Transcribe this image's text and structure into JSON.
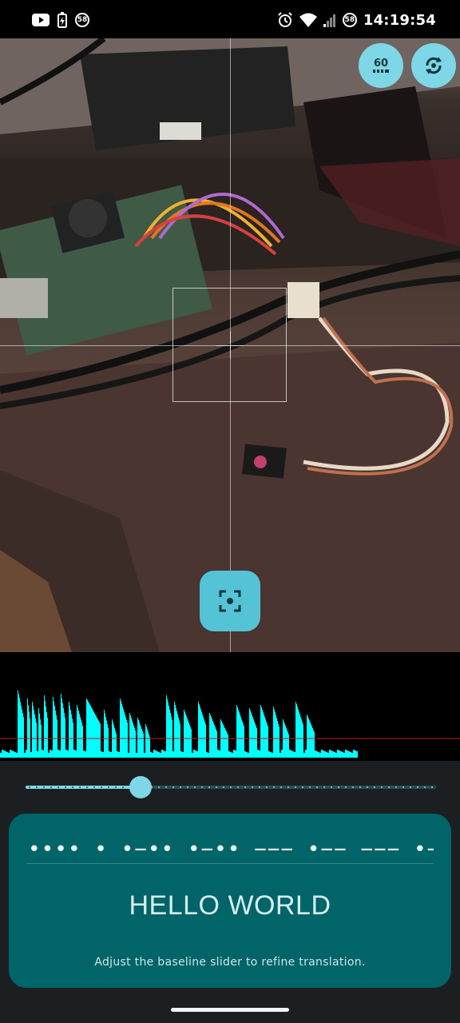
{
  "status_bar": {
    "time": "14:19:54",
    "notification_badge": "58",
    "battery_badge": "58",
    "icons_left": [
      "youtube-icon",
      "battery-saver-icon",
      "badge-58-icon"
    ],
    "icons_right": [
      "alarm-icon",
      "wifi-icon",
      "signal-icon",
      "badge-58-icon"
    ]
  },
  "camera": {
    "fps_button": {
      "label": "60",
      "icon": "fps-icon"
    },
    "switch_camera_button": {
      "icon": "switch-camera-icon"
    },
    "capture_button": {
      "icon": "focus-center-icon"
    }
  },
  "waveform": {
    "color": "#00ffff",
    "baseline_color": "#cc1a1a"
  },
  "baseline_slider": {
    "value": 0.28
  },
  "translation_card": {
    "morse": "•••• • •−•• •−•• −−−  •−− −−− •−• •−•• −••",
    "text": "HELLO WORLD",
    "hint": "Adjust the baseline slider to refine translation."
  },
  "colors": {
    "accent": "#7ed7e6",
    "card": "#006468",
    "panel": "#1c1f22"
  }
}
